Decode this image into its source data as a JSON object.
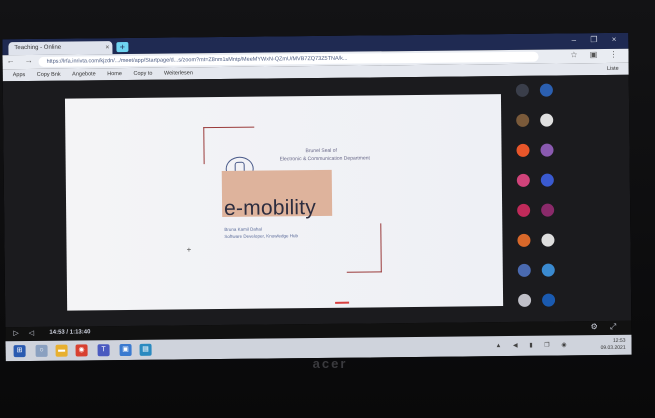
{
  "browser": {
    "tab_title": "Teaching - Online",
    "tab_close": "×",
    "new_tab": "+",
    "window_controls": "– ❐ ×",
    "nav_buttons": "← → ⟳",
    "url": "https://lrfa.inrivta.com/kjzdn/.../meet/app/Startpage/d...s/zoom?mt=Z8nm1sMntp/MeeMYWxN-QZmU/MVB7ZQ73Z5TNA/k...",
    "extension_icons": "☆ ▣ ⋮",
    "bookmarks": [
      "Apps",
      "Copy Bnk",
      "Angebote",
      "Home",
      "Copy to",
      "Weiterlesen"
    ],
    "bookmarks_right": "Liste"
  },
  "slide": {
    "department_line_1": "Brunel Seal of",
    "department_line_2": "Electronic & Communication Department",
    "title": "e-mobility",
    "presenter": "Bruna Kamil Dahal",
    "presenter_role": "Software Developer, Knowledge Hub"
  },
  "participants": [
    {
      "name": "",
      "color": "#3a3e4a"
    },
    {
      "name": "",
      "color": "#2b5fb0"
    },
    {
      "name": "",
      "color": "#7a5a3a"
    },
    {
      "name": "",
      "color": "#e0e0e0"
    },
    {
      "name": "",
      "color": "#e8562a"
    },
    {
      "name": "",
      "color": "#8a5ab0"
    },
    {
      "name": "",
      "color": "#d0437a"
    },
    {
      "name": "",
      "color": "#3a5ad0"
    },
    {
      "name": "",
      "color": "#c02a5a"
    },
    {
      "name": "",
      "color": "#8a2a6a"
    },
    {
      "name": "",
      "color": "#d8682a"
    },
    {
      "name": "",
      "color": "#dedede"
    },
    {
      "name": "",
      "color": "#4a6ab0"
    },
    {
      "name": "",
      "color": "#3a8ad0"
    },
    {
      "name": "",
      "color": "#c0c0c8"
    },
    {
      "name": "",
      "color": "#1a5ab0"
    }
  ],
  "controls": {
    "left_icons": "▷ ◁",
    "time": "14:53 / 1:13:40",
    "right_icons": "⚙ ⤢"
  },
  "taskbar": {
    "tray": "▲ ◀ ▮ ❐ ◉",
    "clock_time": "12:53",
    "clock_date": "09.03.2021"
  },
  "monitor": {
    "brand": "acer"
  },
  "colors": {
    "browser_tab_bar": "#1f2a52",
    "slide_highlight": "#deb39c",
    "accent_blue": "#2b5fb0"
  }
}
